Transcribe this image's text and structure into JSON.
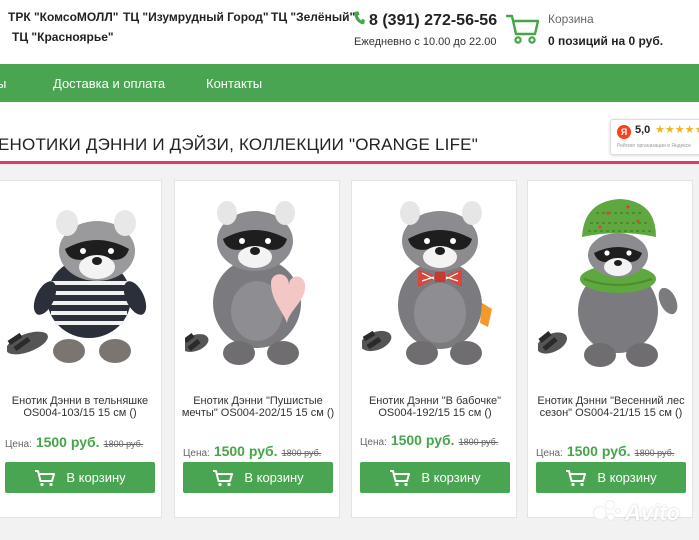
{
  "header": {
    "malls": [
      "ТРК \"КомсоМОЛЛ\"",
      "ТЦ \"Изумрудный Город\"",
      "ТЦ \"Зелёный\"",
      "ТЦ \"Красноярье\""
    ],
    "phone": "8 (391) 272-56-56",
    "hours": "Ежедневно с 10.00 до 22.00",
    "cart_label": "Корзина",
    "cart_status": "0 позиций на 0 руб.",
    "icons": [
      "phone-icon",
      "cart-icon"
    ]
  },
  "nav": {
    "partial_item": "ы",
    "items": [
      "Доставка и оплата",
      "Контакты"
    ]
  },
  "page": {
    "title": "ЕНОТИКИ ДЭННИ И ДЭЙЗИ, КОЛЛЕКЦИИ \"ORANGE LIFE\""
  },
  "rating": {
    "logo": "Я",
    "value": "5,0",
    "stars": "★★★★★",
    "caption": "Рейтинг организации в Яндексе"
  },
  "products": [
    {
      "name": "Енотик Дэнни в тельняшке OS004-103/15 15 см ()",
      "price_label": "Цена:",
      "price": "1500 руб.",
      "old_price": "1800 руб.",
      "button": "В корзину"
    },
    {
      "name": "Енотик Дэнни \"Пушистые мечты\" OS004-202/15 15 см ()",
      "price_label": "Цена:",
      "price": "1500 руб.",
      "old_price": "1800 руб.",
      "button": "В корзину"
    },
    {
      "name": "Енотик Дэнни \"В бабочке\" OS004-192/15 15 см ()",
      "price_label": "Цена:",
      "price": "1500 руб.",
      "old_price": "1800 руб.",
      "button": "В корзину"
    },
    {
      "name": "Енотик Дэнни \"Весенний лес сезон\" OS004-21/15 15 см ()",
      "price_label": "Цена:",
      "price": "1500 руб.",
      "old_price": "1800 руб.",
      "button": "В корзину"
    }
  ],
  "watermark": {
    "text": "Avito"
  },
  "colors": {
    "accent_green": "#4aa552",
    "price_green": "#45a548",
    "title_underline": "#e5386a"
  }
}
